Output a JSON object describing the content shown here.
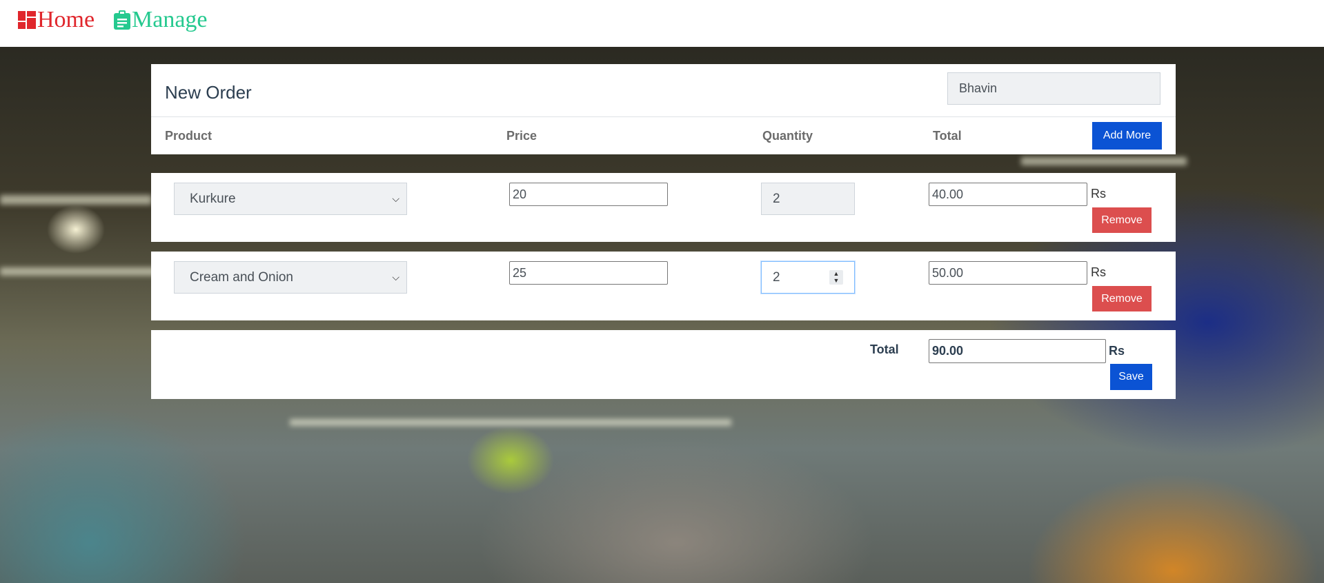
{
  "nav": {
    "home_label": "Home",
    "manage_label": "Manage",
    "home_color": "#e0262c",
    "manage_color": "#25c98f"
  },
  "order": {
    "title": "New Order",
    "customer_name": "Bhavin",
    "columns": [
      "Product",
      "Price",
      "Quantity",
      "Total"
    ],
    "add_more_label": "Add More",
    "rows": [
      {
        "product": "Kurkure",
        "price": "20",
        "quantity": "2",
        "total": "40.00",
        "unit": "Rs",
        "remove_label": "Remove"
      },
      {
        "product": "Cream and Onion",
        "price": "25",
        "quantity": "2",
        "total": "50.00",
        "unit": "Rs",
        "remove_label": "Remove"
      }
    ],
    "grand_total_label": "Total",
    "grand_total": "90.00",
    "grand_total_unit": "Rs",
    "save_label": "Save"
  },
  "colors": {
    "primary_button": "#0b53d4",
    "danger_button": "#dc4e4e"
  }
}
